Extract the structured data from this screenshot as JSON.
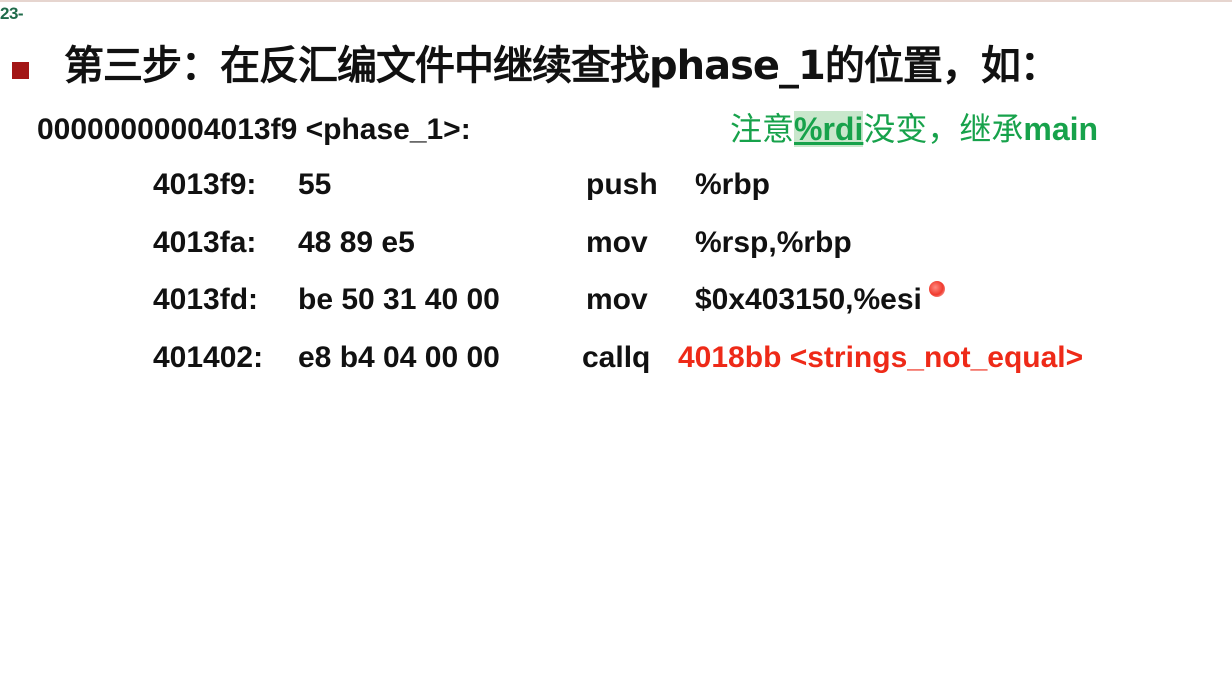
{
  "slide": {
    "page_number": "23-",
    "heading": "第三步：在反汇编文件中继续查找phase_1的位置，如：",
    "function_label": "00000000004013f9 <phase_1>:",
    "note": {
      "prefix": "注意",
      "register": "%rdi",
      "middle": "没变，继承",
      "suffix": "main"
    },
    "rows": [
      {
        "address": "4013f9:",
        "bytes": "55",
        "op": "push",
        "operands": "%rbp"
      },
      {
        "address": "4013fa:",
        "bytes": "48 89 e5",
        "op": "mov",
        "operands": "%rsp,%rbp"
      },
      {
        "address": "4013fd:",
        "bytes": "be 50 31 40 00",
        "op": "mov",
        "operands": "$0x403150,%esi"
      },
      {
        "address": "401402:",
        "bytes": "e8 b4 04 00 00",
        "op": "callq",
        "operands": "4018bb <strings_not_equal>"
      }
    ],
    "colors": {
      "bullet": "#a31515",
      "note_green": "#17a24b",
      "call_red": "#ee2a18",
      "page_num": "#1f6b4a"
    }
  }
}
